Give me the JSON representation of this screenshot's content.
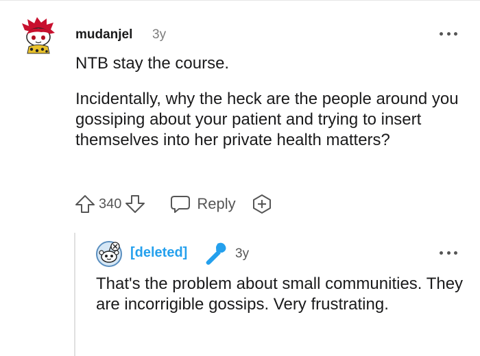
{
  "comment1": {
    "username": "mudanjel",
    "time": "3y",
    "paragraphs": [
      "NTB stay the course.",
      "Incidentally, why the heck are the people around you gossiping about your patient and trying to insert themselves into her private health matters?"
    ],
    "votes": "340",
    "reply_label": "Reply",
    "avatar_icon": "snoo-avatar-red-hair"
  },
  "comment2": {
    "username": "[deleted]",
    "time": "3y",
    "body": "That's the problem about small communities. They are incorrigible gossips. Very frustrating.",
    "avatar_icon": "snoo-avatar-default",
    "badge_icon": "microphone-icon"
  },
  "colors": {
    "deleted_user": "#24a0ed",
    "text": "#1a1a1b",
    "muted": "#7c7c7c"
  }
}
